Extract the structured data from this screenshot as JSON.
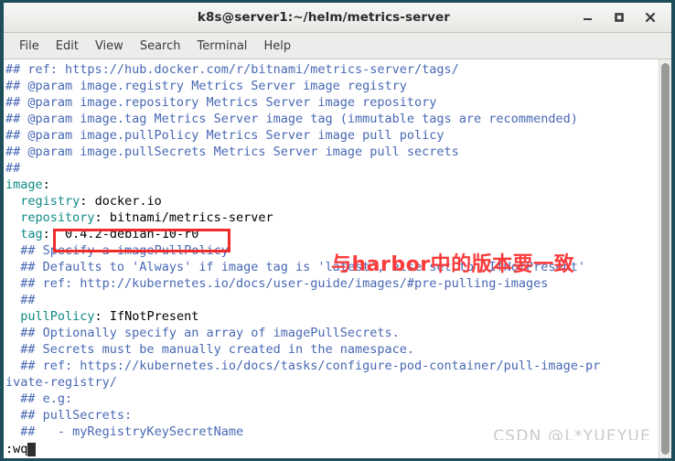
{
  "window": {
    "title": "k8s@server1:~/helm/metrics-server",
    "controls": [
      {
        "name": "minimize",
        "label": "_"
      },
      {
        "name": "maximize",
        "label": "□"
      },
      {
        "name": "close",
        "label": "×"
      }
    ]
  },
  "menubar": {
    "items": [
      {
        "label": "File"
      },
      {
        "label": "Edit"
      },
      {
        "label": "View"
      },
      {
        "label": "Search"
      },
      {
        "label": "Terminal"
      },
      {
        "label": "Help"
      }
    ]
  },
  "editor": {
    "lines": [
      {
        "comment": "## ref: https://hub.docker.com/r/bitnami/metrics-server/tags/"
      },
      {
        "comment": "## @param image.registry Metrics Server image registry"
      },
      {
        "comment": "## @param image.repository Metrics Server image repository"
      },
      {
        "comment": "## @param image.tag Metrics Server image tag (immutable tags are recommended)"
      },
      {
        "comment": "## @param image.pullPolicy Metrics Server image pull policy"
      },
      {
        "comment": "## @param image.pullSecrets Metrics Server image pull secrets"
      },
      {
        "comment": "##"
      },
      {
        "key": "image",
        "punct": ":",
        "value": ""
      },
      {
        "indent": "  ",
        "key": "registry",
        "punct": ":",
        "value": " docker.io"
      },
      {
        "indent": "  ",
        "key": "repository",
        "punct": ":",
        "value": " bitnami/metrics-server"
      },
      {
        "indent": "  ",
        "key": "tag",
        "punct": ":",
        "value": "  0.4.2-debian-10-r0",
        "boxed": true
      },
      {
        "indent": "  ",
        "comment": "## Specify a imagePullPolicy"
      },
      {
        "indent": "  ",
        "comment": "## Defaults to 'Always' if image tag is 'latest', else set to 'IfNotPresent'"
      },
      {
        "indent": "  ",
        "comment": "## ref: http://kubernetes.io/docs/user-guide/images/#pre-pulling-images"
      },
      {
        "indent": "  ",
        "comment": "##"
      },
      {
        "indent": "  ",
        "key": "pullPolicy",
        "punct": ":",
        "value": " IfNotPresent"
      },
      {
        "indent": "  ",
        "comment": "## Optionally specify an array of imagePullSecrets."
      },
      {
        "indent": "  ",
        "comment": "## Secrets must be manually created in the namespace."
      },
      {
        "indent": "  ",
        "comment": "## ref: https://kubernetes.io/docs/tasks/configure-pod-container/pull-image-pr"
      },
      {
        "comment": "ivate-registry/"
      },
      {
        "indent": "  ",
        "comment": "## e.g:"
      },
      {
        "indent": "  ",
        "comment": "## pullSecrets:"
      },
      {
        "indent": "  ",
        "comment": "##   - myRegistryKeySecretName"
      }
    ]
  },
  "annotation": {
    "text": "与harbor中的版本要一致",
    "color": "#fa3c3c"
  },
  "statusline": {
    "command": ":wq"
  },
  "watermark": {
    "text": "CSDN @L*YUEYUE"
  },
  "colors": {
    "comment": "#4868b4",
    "key": "#0f8a86",
    "value": "#000000",
    "frame": "#1d4e5a",
    "titlebar": "#efeeec",
    "menubar": "#edecea",
    "background": "#ffffff",
    "annotation_box": "#f12a2a",
    "scroll_thumb": "#9a9a9a"
  }
}
